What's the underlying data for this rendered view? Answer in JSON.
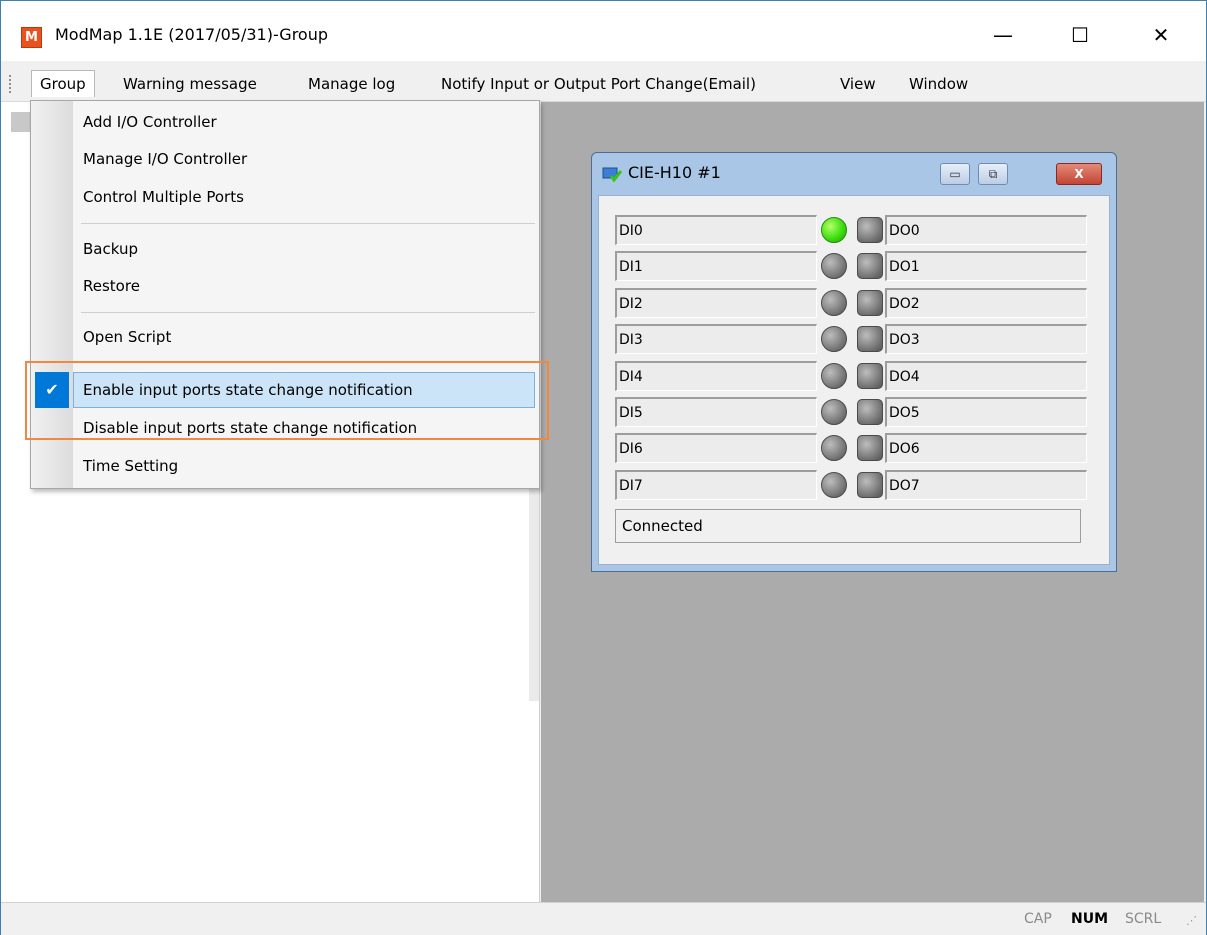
{
  "window": {
    "title": "ModMap 1.1E (2017/05/31)-Group",
    "app_icon_letter": "M"
  },
  "title_buttons": {
    "minimize": "—",
    "maximize": "☐",
    "close": "✕"
  },
  "menubar": [
    {
      "label": "Group",
      "open": true
    },
    {
      "label": "Warning message"
    },
    {
      "label": "Manage log"
    },
    {
      "label": "Notify Input or Output Port Change(Email)"
    },
    {
      "label": "View"
    },
    {
      "label": "Window"
    }
  ],
  "group_menu": {
    "items": [
      {
        "label": "Add I/O Controller"
      },
      {
        "label": "Manage I/O Controller"
      },
      {
        "label": "Control Multiple Ports"
      },
      {
        "label": "Backup"
      },
      {
        "label": "Restore"
      },
      {
        "label": "Open Script"
      },
      {
        "label": "Enable input ports state change notification",
        "checked": true,
        "highlighted": true
      },
      {
        "label": "Disable input ports state change notification"
      },
      {
        "label": "Time Setting"
      }
    ],
    "check_mark": "✔"
  },
  "child_window": {
    "title": "CIE-H10 #1",
    "buttons": {
      "minimize": "▭",
      "restore": "⧉",
      "close": "X"
    },
    "inputs": [
      "DI0",
      "DI1",
      "DI2",
      "DI3",
      "DI4",
      "DI5",
      "DI6",
      "DI7"
    ],
    "outputs": [
      "DO0",
      "DO1",
      "DO2",
      "DO3",
      "DO4",
      "DO5",
      "DO6",
      "DO7"
    ],
    "input_states": [
      true,
      false,
      false,
      false,
      false,
      false,
      false,
      false
    ],
    "output_states": [
      false,
      false,
      false,
      false,
      false,
      false,
      false,
      false
    ],
    "status": "Connected"
  },
  "statusbar": {
    "cap": "CAP",
    "num": "NUM",
    "scrl": "SCRL"
  },
  "colors": {
    "highlight": "#cce4f7",
    "check_bg": "#0078d7",
    "led_on": "#3ddf10",
    "mdi_bg": "#ababab",
    "annotation": "#f0883f"
  }
}
